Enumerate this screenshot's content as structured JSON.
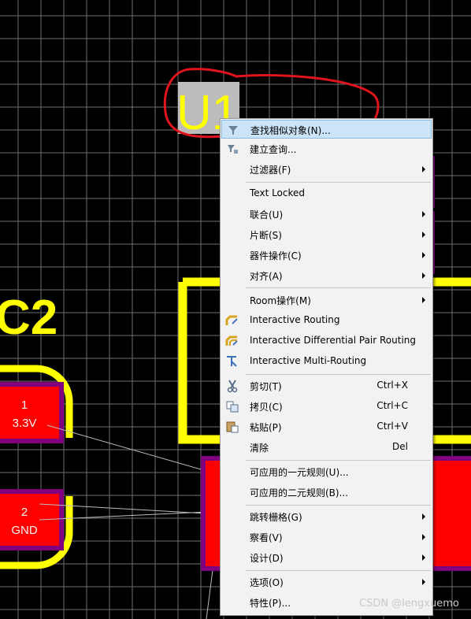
{
  "pcb": {
    "designator_u1": "U1",
    "designator_c2": "C2",
    "pad1": {
      "num": "1",
      "net": "3.3V"
    },
    "pad2": {
      "num": "2",
      "net": "GND"
    }
  },
  "colors": {
    "background": "#000000",
    "grid": "#6f6f6f",
    "silkscreen": "#ffff00",
    "pad": "#ff0000",
    "pad_border": "#800080",
    "annotation": "#e0141e",
    "menu_bg": "#f2f2f2",
    "menu_highlight": "#cce4f7"
  },
  "context_menu": {
    "items": [
      {
        "label": "查找相似对象(N)...",
        "icon": "find-similar-icon"
      },
      {
        "label": "建立查询...",
        "icon": "query-icon"
      },
      {
        "label": "过滤器(F)",
        "submenu": true
      },
      {
        "label": "Text Locked"
      },
      {
        "label": "联合(U)",
        "submenu": true
      },
      {
        "label": "片断(S)",
        "submenu": true
      },
      {
        "label": "器件操作(C)",
        "submenu": true
      },
      {
        "label": "对齐(A)",
        "submenu": true
      },
      {
        "label": "Room操作(M)",
        "submenu": true
      },
      {
        "label": "Interactive Routing",
        "icon": "interactive-routing-icon"
      },
      {
        "label": "Interactive Differential Pair Routing",
        "icon": "diff-pair-routing-icon"
      },
      {
        "label": "Interactive Multi-Routing",
        "icon": "multi-routing-icon"
      },
      {
        "label": "剪切(T)",
        "shortcut": "Ctrl+X",
        "icon": "cut-icon"
      },
      {
        "label": "拷贝(C)",
        "shortcut": "Ctrl+C",
        "icon": "copy-icon"
      },
      {
        "label": "粘贴(P)",
        "shortcut": "Ctrl+V",
        "icon": "paste-icon"
      },
      {
        "label": "清除",
        "shortcut": "Del"
      },
      {
        "label": "可应用的一元规则(U)..."
      },
      {
        "label": "可应用的二元规则(B)..."
      },
      {
        "label": "跳转栅格(G)",
        "submenu": true
      },
      {
        "label": "察看(V)",
        "submenu": true
      },
      {
        "label": "设计(D)",
        "submenu": true
      },
      {
        "label": "选项(O)",
        "submenu": true
      },
      {
        "label": "特性(P)..."
      }
    ]
  },
  "watermark": "CSDN @lengxuemo"
}
